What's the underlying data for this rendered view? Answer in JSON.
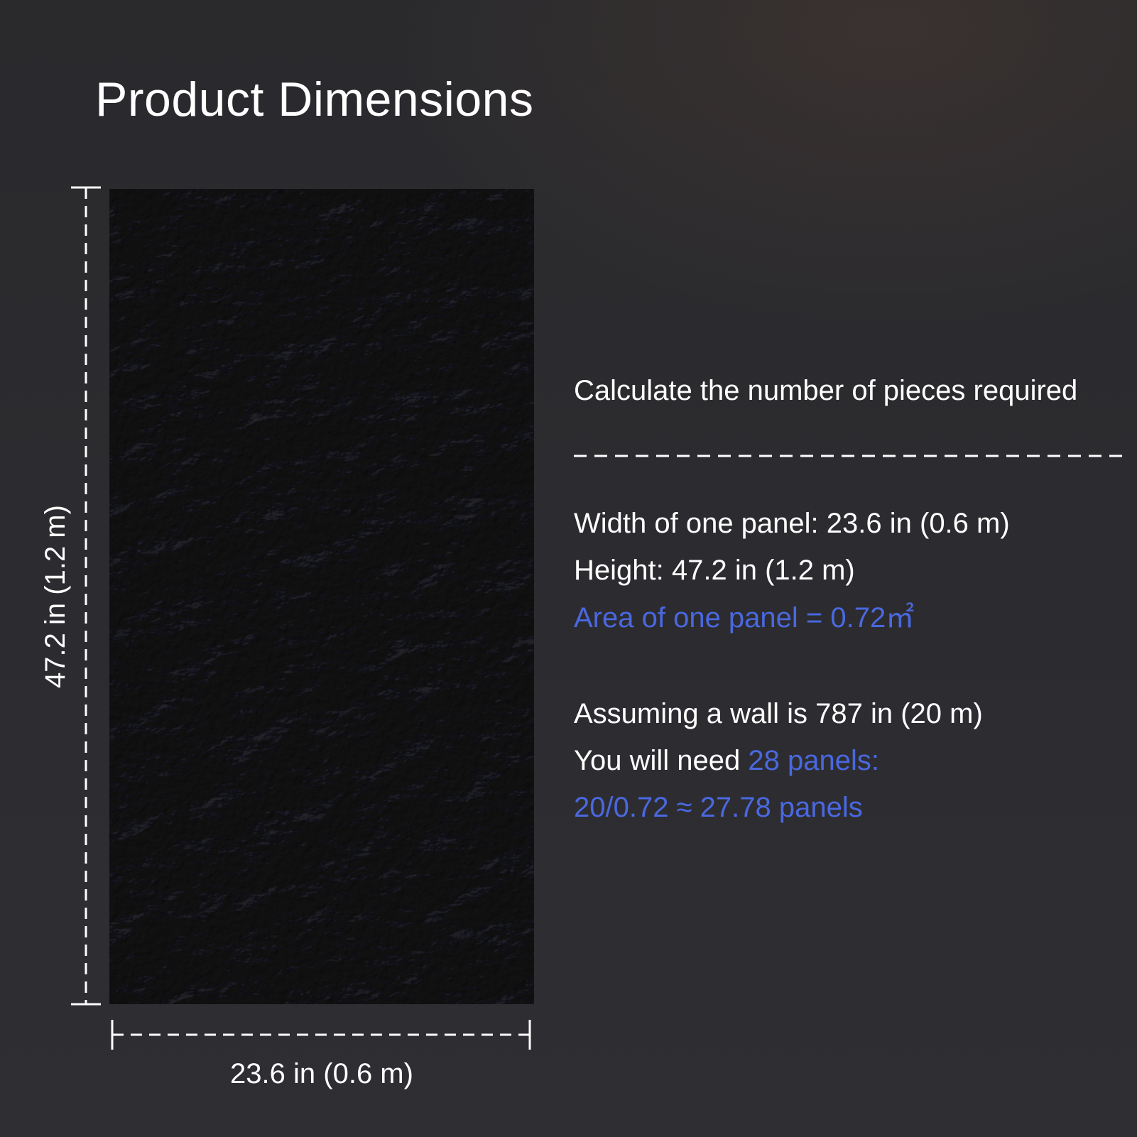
{
  "title": "Product Dimensions",
  "panel_image": "stone-texture-panel",
  "dimensions": {
    "height_label": "47.2 in (1.2 m)",
    "width_label": "23.6 in (0.6 m)"
  },
  "calculation": {
    "heading": "Calculate the number of pieces required",
    "width_line": "Width of one panel: 23.6 in (0.6 m)",
    "height_line": "Height: 47.2 in (1.2 m)",
    "area_line": "Area of one panel = 0.72㎡",
    "wall_line": "Assuming a wall is 787 in (20 m)",
    "need_prefix": "You will need ",
    "need_value": "28 panels:",
    "formula_line": "20/0.72 ≈ 27.78 panels"
  },
  "colors": {
    "accent_blue": "#4a68e0",
    "background": "#2c2c30",
    "text": "#ffffff"
  }
}
